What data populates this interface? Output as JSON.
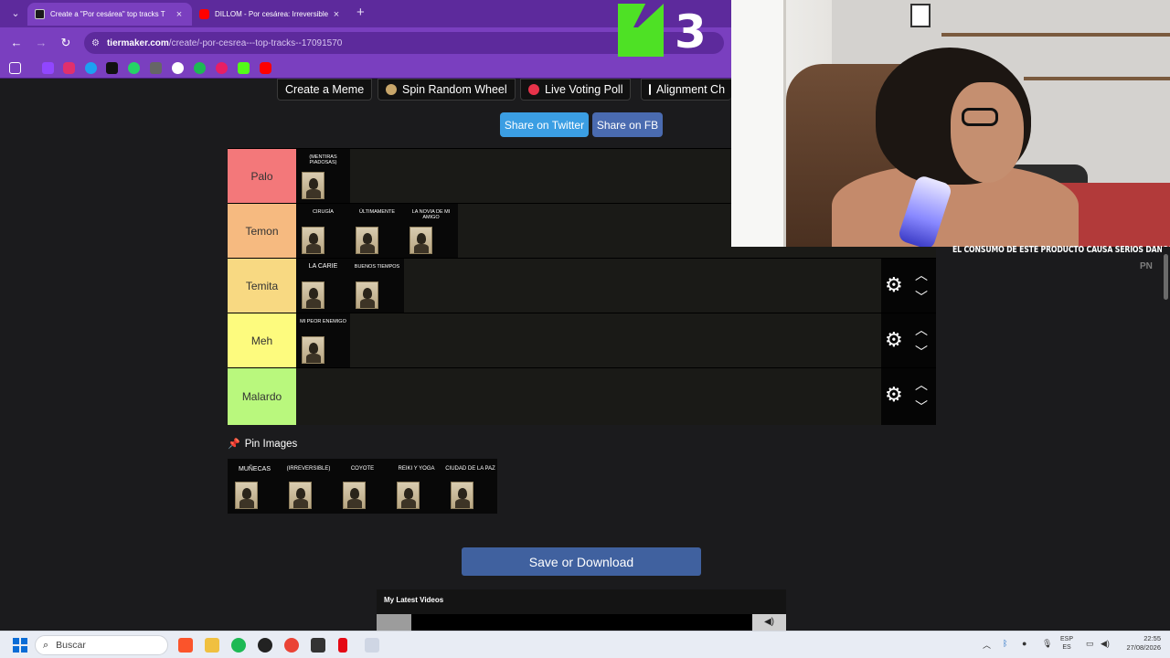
{
  "browser": {
    "tabs": [
      {
        "title": "Create a \"Por cesárea\" top tracks T",
        "close": "×",
        "favicon_color": "#1a1a1a"
      },
      {
        "title": "DILLOM - Por cesárea: Irreversible",
        "close": "×",
        "favicon_color": "#ff0000"
      }
    ],
    "new_tab": "+",
    "url_prefix": "tiermaker.com",
    "url_rest": "/create/-por-cesrea---top-tracks--17091570",
    "overlay_logo_number": "3"
  },
  "site": {
    "top_buttons": [
      {
        "label": "Create a Meme"
      },
      {
        "label": "Spin Random Wheel"
      },
      {
        "label": "Live Voting Poll"
      },
      {
        "label": "Alignment Ch"
      }
    ],
    "share_twitter": "Share on Twitter",
    "share_fb": "Share on FB",
    "tiers": [
      {
        "label": "Palo",
        "color": "#f3787a",
        "songs": [
          "(MENTIRAS PIADOSAS)"
        ]
      },
      {
        "label": "Temon",
        "color": "#f6ba80",
        "songs": [
          "CIRUGÍA",
          "ÚLTIMAMENTE",
          "LA NOVIA DE MI AMIGO"
        ]
      },
      {
        "label": "Temita",
        "color": "#f8d982",
        "songs": [
          "LA CARIE",
          "BUENOS TIEMPOS"
        ]
      },
      {
        "label": "Meh",
        "color": "#fdfb7e",
        "songs": [
          "MI PEOR ENEMIGO"
        ]
      },
      {
        "label": "Malardo",
        "color": "#b9f87d",
        "songs": []
      }
    ],
    "pin_images_label": "Pin Images",
    "pinned_songs": [
      "MUÑECAS",
      "(IRREVERSIBLE)",
      "COYOTE",
      "REIKI Y YOGA",
      "CIUDAD DE LA PAZ"
    ],
    "save_button": "Save or Download",
    "latest_videos": "My Latest Videos"
  },
  "overlay": {
    "warning": "EL CONSUMO DE ESTE PRODUCTO CAUSA SERIOS DANOS A LA SALUD",
    "tag": "PN"
  },
  "taskbar": {
    "search_placeholder": "Buscar",
    "lang_top": "ESP",
    "lang_bottom": "ES",
    "time": "22:55",
    "date": "27/08/2026"
  }
}
